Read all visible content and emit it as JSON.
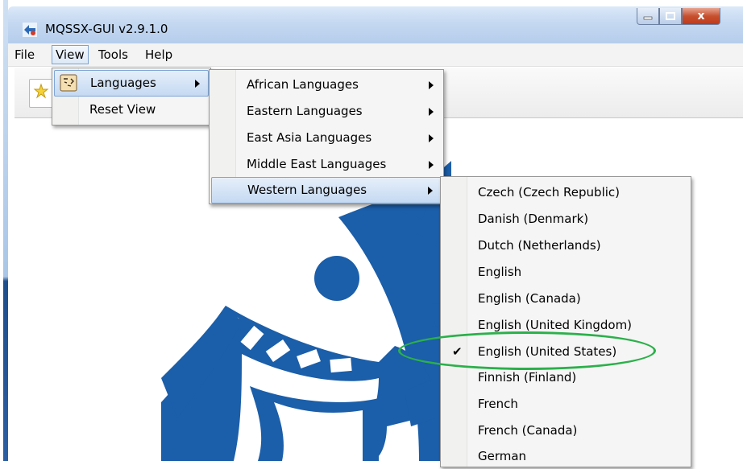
{
  "window": {
    "title": "MQSSX-GUI v2.9.1.0",
    "close_label": "x"
  },
  "menubar": {
    "items": [
      "File",
      "View",
      "Tools",
      "Help"
    ]
  },
  "view_menu": {
    "items": [
      {
        "label": "Languages",
        "submenu": true
      },
      {
        "label": "Reset View",
        "submenu": false
      }
    ]
  },
  "languages_menu": {
    "items": [
      {
        "label": "African Languages",
        "submenu": true
      },
      {
        "label": "Eastern Languages",
        "submenu": true
      },
      {
        "label": "East Asia Languages",
        "submenu": true
      },
      {
        "label": "Middle East Languages",
        "submenu": true
      },
      {
        "label": "Western Languages",
        "submenu": true
      }
    ]
  },
  "western_menu": {
    "checked": "English (United States)",
    "checkmark": "✔",
    "items": [
      "Czech (Czech Republic)",
      "Danish (Denmark)",
      "Dutch (Netherlands)",
      "English",
      "English (Canada)",
      "English (United Kingdom)",
      "English (United States)",
      "Finnish (Finland)",
      "French",
      "French (Canada)",
      "German"
    ]
  },
  "colors": {
    "logo": "#1b5ea9",
    "highlight_border": "#7fa6d6",
    "annotation": "#2bb04a"
  },
  "icons": {
    "app": "app-logo-icon",
    "toolbar_new": "new-star-icon",
    "languages": "face-speech-icon"
  }
}
